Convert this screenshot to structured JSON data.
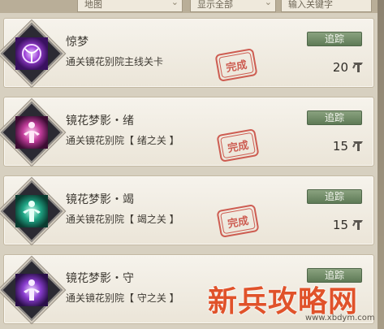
{
  "filters": {
    "map": "地图",
    "show": "显示全部",
    "search_placeholder": "输入关键字"
  },
  "quests": [
    {
      "title": "惊梦",
      "desc": "通关镜花别院主线关卡",
      "track": "追踪",
      "reward": "20",
      "completed": true,
      "stamp": "完成",
      "icon": "purple-orb-icon"
    },
    {
      "title": "镜花梦影・绪",
      "desc": "通关镜花别院【 绪之关 】",
      "track": "追踪",
      "reward": "15",
      "completed": true,
      "stamp": "完成",
      "icon": "pink-figure-icon"
    },
    {
      "title": "镜花梦影・竭",
      "desc": "通关镜花别院【 竭之关 】",
      "track": "追踪",
      "reward": "15",
      "completed": true,
      "stamp": "完成",
      "icon": "teal-figure-icon"
    },
    {
      "title": "镜花梦影・守",
      "desc": "通关镜花别院【 守之关 】",
      "track": "追踪",
      "reward": "",
      "completed": false,
      "stamp": "",
      "icon": "violet-figure-icon"
    }
  ],
  "watermark": {
    "main": "新兵攻略网",
    "url": "www.xbdym.com"
  }
}
